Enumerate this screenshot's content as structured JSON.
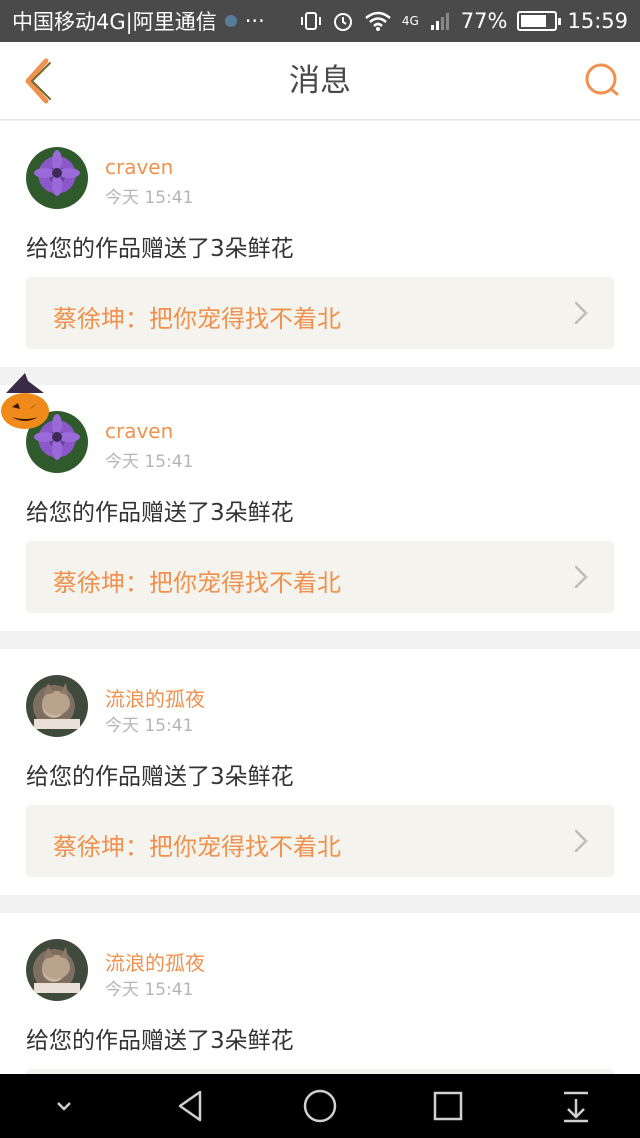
{
  "status_bar": {
    "carrier": "中国移动4G|阿里通信",
    "more": "···",
    "network": "4G",
    "battery_percent": "77%",
    "battery_level": 0.77,
    "time": "15:59"
  },
  "nav": {
    "title": "消息"
  },
  "messages": [
    {
      "username": "craven",
      "time": "今天 15:41",
      "text": "给您的作品赠送了3朵鲜花",
      "quote": "蔡徐坤：把你宠得找不着北",
      "avatar": "flower-avatar"
    },
    {
      "username": "craven",
      "time": "今天 15:41",
      "text": "给您的作品赠送了3朵鲜花",
      "quote": "蔡徐坤：把你宠得找不着北",
      "avatar": "flower-avatar"
    },
    {
      "username": "流浪的孤夜",
      "time": "今天 15:41",
      "text": "给您的作品赠送了3朵鲜花",
      "quote": "蔡徐坤：把你宠得找不着北",
      "avatar": "cat-avatar"
    },
    {
      "username": "流浪的孤夜",
      "time": "今天 15:41",
      "text": "给您的作品赠送了3朵鲜花",
      "quote": "",
      "avatar": "cat-avatar"
    }
  ],
  "colors": {
    "accent": "#f0914d",
    "status_bar": "#4a4a4a",
    "quote_bg": "#f5f3ee",
    "page_bg": "#f2f2f2"
  },
  "icons": [
    "back-icon",
    "search-icon",
    "chevron-right-icon",
    "pumpkin-hat-icon",
    "collapse-icon",
    "back-triangle-icon",
    "home-circle-icon",
    "recents-square-icon",
    "pull-down-icon"
  ]
}
